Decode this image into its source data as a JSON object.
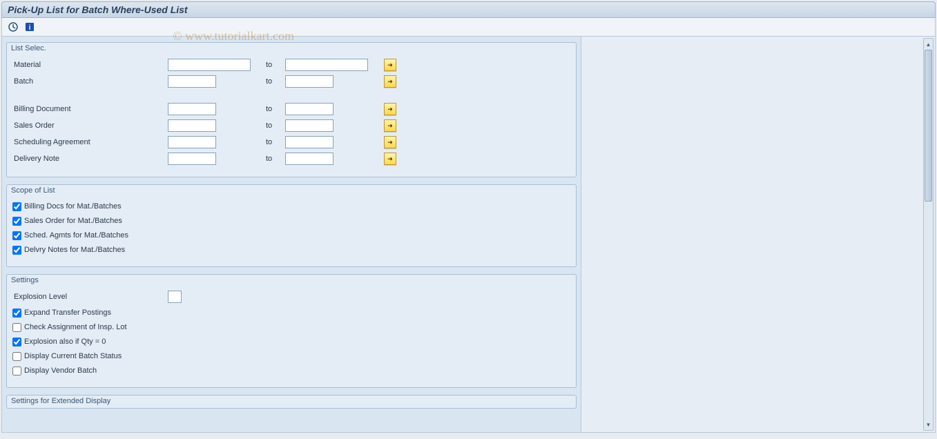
{
  "page_title": "Pick-Up List for Batch Where-Used List",
  "watermark": "© www.tutorialkart.com",
  "to_label": "to",
  "groups": {
    "list_selec": {
      "title": "List Selec.",
      "rows": {
        "material": "Material",
        "batch": "Batch",
        "billing_doc": "Billing Document",
        "sales_order": "Sales Order",
        "sched_agree": "Scheduling Agreement",
        "delivery_note": "Delivery Note"
      }
    },
    "scope": {
      "title": "Scope of List",
      "items": {
        "billing_docs": "Billing Docs for Mat./Batches",
        "sales_order": "Sales Order for Mat./Batches",
        "sched_agmts": "Sched. Agmts for Mat./Batches",
        "delvry_notes": "Delvry Notes for Mat./Batches"
      }
    },
    "settings": {
      "title": "Settings",
      "explosion_level": "Explosion Level",
      "items": {
        "expand_transfer": "Expand Transfer Postings",
        "check_assignment": "Check Assignment of Insp. Lot",
        "explosion_qty0": "Explosion also if Qty = 0",
        "disp_batch_status": "Display Current Batch Status",
        "disp_vendor_batch": "Display Vendor Batch"
      }
    },
    "extended": {
      "title": "Settings for Extended Display"
    }
  },
  "scope_checked": {
    "billing_docs": true,
    "sales_order": true,
    "sched_agmts": true,
    "delvry_notes": true
  },
  "settings_checked": {
    "expand_transfer": true,
    "check_assignment": false,
    "explosion_qty0": true,
    "disp_batch_status": false,
    "disp_vendor_batch": false
  }
}
